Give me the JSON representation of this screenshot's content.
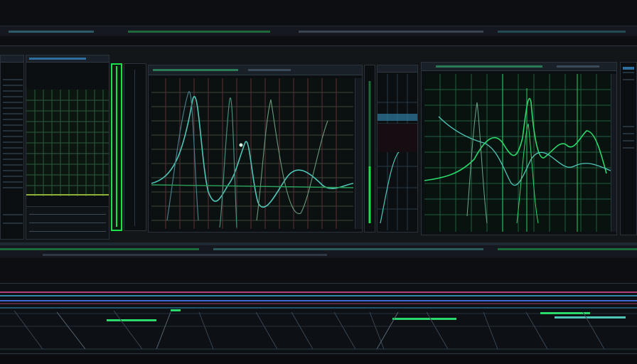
{
  "app": {
    "accent": "#19e24a",
    "trace_green": "#2bd86a",
    "trace_teal": "#4fc7b8",
    "trace_cyan": "#3fb0d9",
    "trace_magenta": "#b0407a",
    "trace_blue": "#4066d0"
  },
  "toolbar": {
    "icons": [
      "menu-strip-icon",
      "track-strip-icon"
    ]
  },
  "browser": {
    "icon": "list-icon"
  },
  "selector": {
    "icon": "channel-select-icon"
  },
  "scope_left": {
    "icon": "waveform-icon"
  },
  "meter": {
    "icon": "level-meter-icon"
  },
  "scope_right": {
    "icon": "spectrum-icon"
  },
  "timeline": {
    "icon": "timeline-icon"
  }
}
